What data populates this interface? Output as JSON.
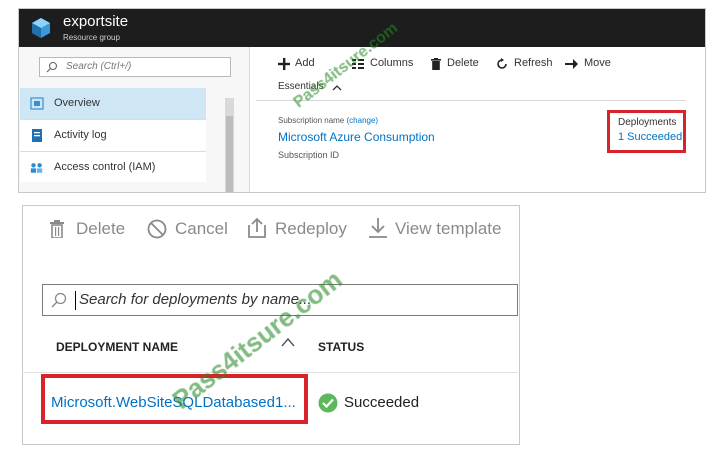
{
  "resource_group": {
    "title": "exportsite",
    "subtitle": "Resource group"
  },
  "sidebar": {
    "search_placeholder": "Search (Ctrl+/)",
    "items": [
      {
        "label": "Overview",
        "icon": "overview-icon",
        "selected": true
      },
      {
        "label": "Activity log",
        "icon": "activity-log-icon"
      },
      {
        "label": "Access control (IAM)",
        "icon": "access-control-icon"
      }
    ]
  },
  "toolbar": {
    "add": "Add",
    "columns": "Columns",
    "delete": "Delete",
    "refresh": "Refresh",
    "move": "Move"
  },
  "essentials": {
    "label": "Essentials",
    "subscription_name_label": "Subscription name",
    "subscription_change": "(change)",
    "subscription_name": "Microsoft Azure Consumption",
    "subscription_id_label": "Subscription ID",
    "deployments_label": "Deployments",
    "deployments_value": "1 Succeeded"
  },
  "deployments_blade": {
    "toolbar": {
      "delete": "Delete",
      "cancel": "Cancel",
      "redeploy": "Redeploy",
      "view_template": "View template"
    },
    "search_placeholder": "Search for deployments by name...",
    "columns": [
      "DEPLOYMENT NAME",
      "STATUS"
    ],
    "rows": [
      {
        "name": "Microsoft.WebSiteSQLDatabased1...",
        "status": "Succeeded"
      }
    ]
  },
  "watermark": {
    "small": "Pass4itsure.com",
    "large": "Pass4itsure.com"
  },
  "colors": {
    "header_bg": "#1d1d1d",
    "link": "#0072c6",
    "highlight_border": "#d8232a",
    "selected_nav": "#cfe7f5",
    "success": "#5cb85c"
  }
}
